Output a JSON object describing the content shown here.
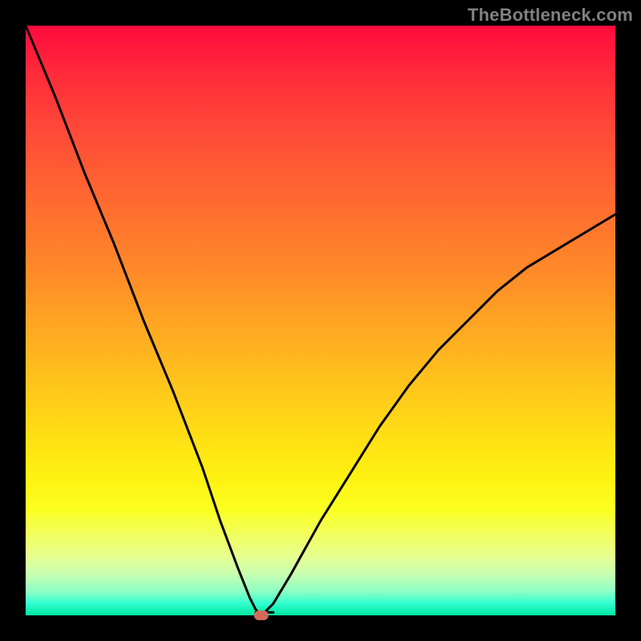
{
  "watermark": "TheBottleneck.com",
  "colors": {
    "frame": "#000000",
    "curve": "#000000",
    "dot": "#d26a5c",
    "axis_label": "#808080",
    "gradient_stops": [
      "#ff0a3c",
      "#ff2a3a",
      "#ff4a38",
      "#ff6a30",
      "#ff8b28",
      "#ffb020",
      "#ffd418",
      "#fff010",
      "#fbff20",
      "#f2ff5a",
      "#e6ff90",
      "#c8ffb0",
      "#8affc5",
      "#30ffd0",
      "#00e6a0"
    ]
  },
  "chart_data": {
    "type": "line",
    "title": "",
    "xlabel": "",
    "ylabel": "",
    "xlim": [
      0,
      100
    ],
    "ylim": [
      0,
      100
    ],
    "grid": false,
    "legend": false,
    "series": [
      {
        "name": "bottleneck-curve",
        "x": [
          0,
          5,
          10,
          15,
          20,
          25,
          30,
          33,
          36,
          38,
          39,
          40,
          42,
          45,
          50,
          55,
          60,
          65,
          70,
          75,
          80,
          85,
          90,
          95,
          100
        ],
        "y": [
          100,
          88,
          75,
          63,
          50,
          38,
          25,
          16,
          8,
          3,
          1,
          0,
          2,
          7,
          16,
          24,
          32,
          39,
          45,
          50,
          55,
          59,
          62,
          65,
          68
        ]
      }
    ],
    "markers": [
      {
        "name": "optimum-dot",
        "x": 40,
        "y": 0
      }
    ],
    "annotations": []
  }
}
